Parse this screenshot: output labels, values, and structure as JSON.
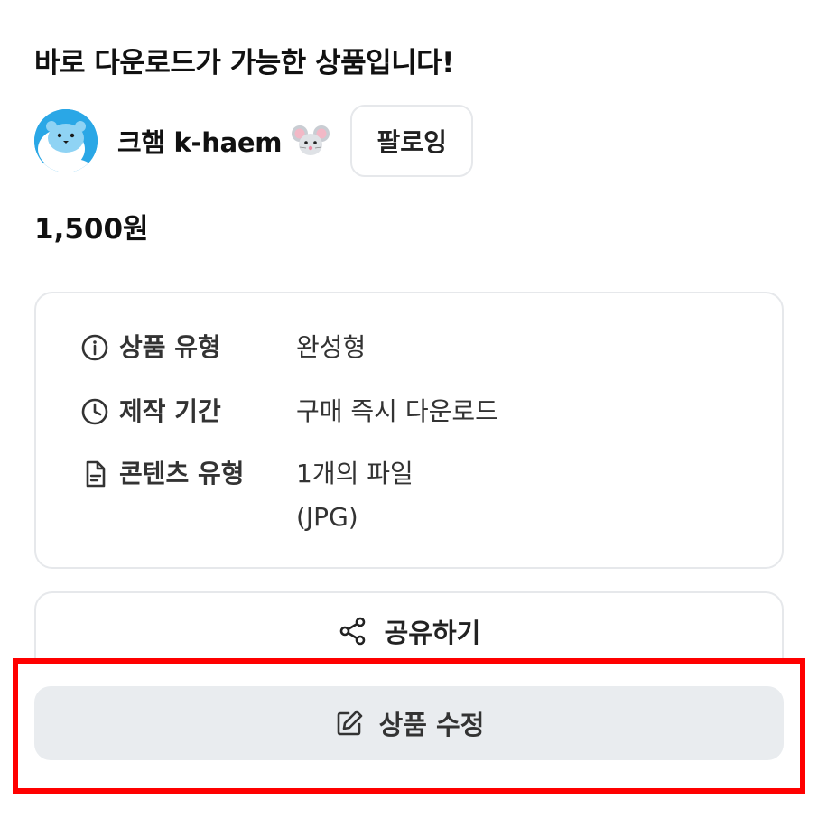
{
  "product": {
    "headline": "바로 다운로드가 가능한 상품입니다!",
    "price": "1,500원"
  },
  "creator": {
    "name": "크햄 k-haem",
    "emoji_icon": "mouse-face-icon",
    "follow_label": "팔로잉"
  },
  "details": [
    {
      "icon": "info-circle-icon",
      "label": "상품 유형",
      "value": "완성형"
    },
    {
      "icon": "clock-icon",
      "label": "제작 기간",
      "value": "구매 즉시 다운로드"
    },
    {
      "icon": "document-icon",
      "label": "콘텐츠 유형",
      "value_line1": "1개의 파일",
      "value_line2": "(JPG)"
    }
  ],
  "actions": {
    "share_label": "공유하기",
    "edit_label": "상품 수정"
  },
  "colors": {
    "highlight": "#ff0000",
    "avatar_bg": "#2aa7e6",
    "edit_button_bg": "#e9ecef",
    "border": "#e6e8eb"
  }
}
